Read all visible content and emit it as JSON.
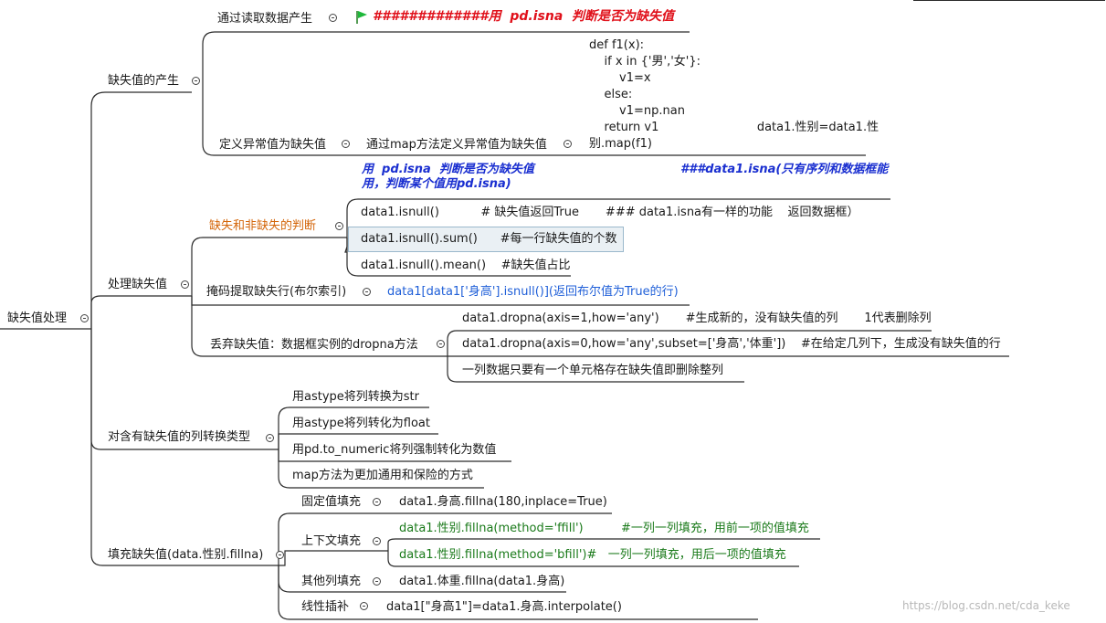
{
  "root": "缺失值处理",
  "branches": {
    "produce": {
      "label": "缺失值的产生",
      "read": "通过读取数据产生",
      "read_note": "#############用  pd.isna  判断是否为缺失值",
      "abnormal": "定义异常值为缺失值",
      "map_method": "通过map方法定义异常值为缺失值",
      "code_lines": [
        "def f1(x):",
        "    if x in {'男','女'}:",
        "        v1=x",
        "    else:",
        "        v1=np.nan",
        "    return v1                          data1.性别=data1.性",
        "别.map(f1)"
      ]
    },
    "handle": {
      "label": "处理缺失值",
      "judge": "缺失和非缺失的判断",
      "note_left": "用  pd.isna  判断是否为缺失值\n用，判断某个值用pd.isna)",
      "note_right": "###data1.isna(只有序列和数据框能",
      "isnull": "data1.isnull()           # 缺失值返回True       ### data1.isna有一样的功能    返回数据框）",
      "isnull_sum": "data1.isnull().sum()      #每一行缺失值的个数",
      "isnull_mean": "data1.isnull().mean()    #缺失值占比",
      "mask": "掩码提取缺失行(布尔索引)",
      "mask_code": "data1[data1['身高'].isnull()](返回布尔值为True的行)",
      "drop": "丢弃缺失值：数据框实例的dropna方法",
      "drop1": "data1.dropna(axis=1,how='any')       #生成新的，没有缺失值的列       1代表删除列",
      "drop2": "data1.dropna(axis=0,how='any',subset=['身高','体重'])    #在给定几列下，生成没有缺失值的行",
      "drop3": "一列数据只要有一个单元格存在缺失值即删除整列"
    },
    "convert": {
      "label": "对含有缺失值的列转换类型",
      "items": [
        "用astype将列转换为str",
        "用astype将列转化为float",
        "用pd.to_numeric将列强制转化为数值",
        "map方法为更加通用和保险的方式"
      ]
    },
    "fill": {
      "label": "填充缺失值(data.性别.fillna)",
      "fixed": "固定值填充",
      "fixed_code": "data1.身高.fillna(180,inplace=True)",
      "context": "上下文填充",
      "ffill": "data1.性别.fillna(method='ffill')          #一列一列填充，用前一项的值填充",
      "bfill": "data1.性别.fillna(method='bfill')#   一列一列填充，用后一项的值填充",
      "other": "其他列填充",
      "other_code": "data1.体重.fillna(data1.身高)",
      "linear": "线性插补",
      "linear_code": "data1[\"身高1\"]=data1.身高.interpolate()"
    }
  },
  "watermark": "https://blog.csdn.net/cda_keke",
  "colors": {
    "line": "#2b2b2b",
    "red_note": "#e0101a",
    "blue_note": "#1a2fd0",
    "orange": "#d4660a",
    "green": "#1a7a1a",
    "link": "#1f5fd8",
    "flag": "#1eb83a"
  }
}
